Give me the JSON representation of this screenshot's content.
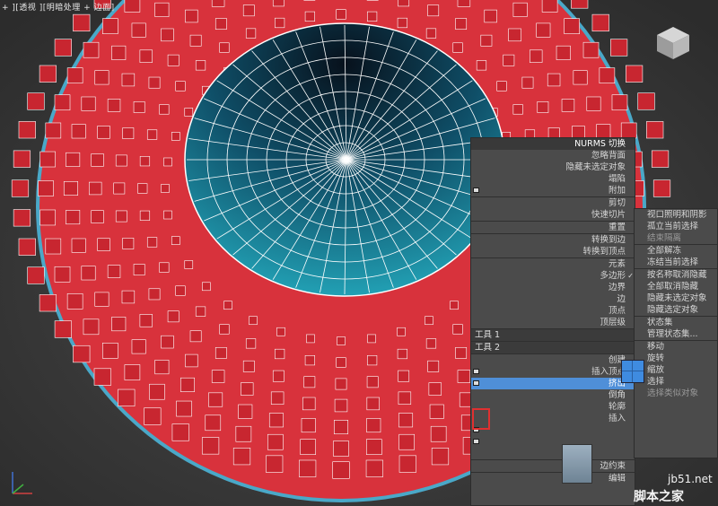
{
  "viewport": {
    "label": "+ ][透视 ][明暗处理 + 边面]"
  },
  "quad_left": {
    "items": [
      {
        "label": "NURMS 切换",
        "type": "title"
      },
      {
        "label": "忽略背面",
        "type": "item"
      },
      {
        "label": "隐藏未选定对象",
        "type": "item"
      },
      {
        "label": "塌陷",
        "type": "item"
      },
      {
        "label": "附加",
        "type": "item"
      },
      {
        "label": "剪切",
        "type": "sep"
      },
      {
        "label": "快速切片",
        "type": "item"
      },
      {
        "label": "重置",
        "type": "sep"
      },
      {
        "label": "转换到边",
        "type": "sep"
      },
      {
        "label": "转换到顶点",
        "type": "item"
      },
      {
        "label": "元素",
        "type": "sep"
      },
      {
        "label": "多边形",
        "type": "item"
      },
      {
        "label": "边界",
        "type": "item"
      },
      {
        "label": "边",
        "type": "item"
      },
      {
        "label": "顶点",
        "type": "item"
      },
      {
        "label": "顶层级",
        "type": "item"
      },
      {
        "label": "工具 1",
        "type": "bar"
      },
      {
        "label": "工具 2",
        "type": "bar"
      },
      {
        "label": "创建",
        "type": "sep"
      },
      {
        "label": "插入顶点",
        "type": "item"
      },
      {
        "label": "挤出",
        "type": "hl"
      },
      {
        "label": "倒角",
        "type": "item"
      },
      {
        "label": "轮廓",
        "type": "item"
      },
      {
        "label": "插入",
        "type": "item"
      },
      {
        "label": "",
        "type": "item"
      },
      {
        "label": "",
        "type": "item"
      },
      {
        "label": "",
        "type": "item"
      }
    ]
  },
  "quad_right": {
    "items": [
      {
        "label": "视口照明和阴影",
        "type": "item"
      },
      {
        "label": "孤立当前选择",
        "type": "item"
      },
      {
        "label": "结束隔离",
        "type": "dim"
      },
      {
        "label": "全部解冻",
        "type": "sep"
      },
      {
        "label": "冻结当前选择",
        "type": "item"
      },
      {
        "label": "按名称取消隐藏",
        "type": "sep"
      },
      {
        "label": "全部取消隐藏",
        "type": "item"
      },
      {
        "label": "隐藏未选定对象",
        "type": "item"
      },
      {
        "label": "隐藏选定对象",
        "type": "item"
      },
      {
        "label": "状态集",
        "type": "sep"
      },
      {
        "label": "管理状态集...",
        "type": "item"
      },
      {
        "label": "移动",
        "type": "sep"
      },
      {
        "label": "旋转",
        "type": "item"
      },
      {
        "label": "缩放",
        "type": "item"
      },
      {
        "label": "选择",
        "type": "item"
      },
      {
        "label": "选择类似对象",
        "type": "dim"
      }
    ]
  },
  "bottom_items": {
    "label_a": "边约束",
    "label_b": "编辑"
  },
  "watermark": {
    "site": "jb51.net",
    "name": "脚本之家"
  },
  "colors": {
    "mesh_red": "#d8323c",
    "edge_cyan": "#4aa8c8",
    "highlight": "#4f8fd8"
  }
}
